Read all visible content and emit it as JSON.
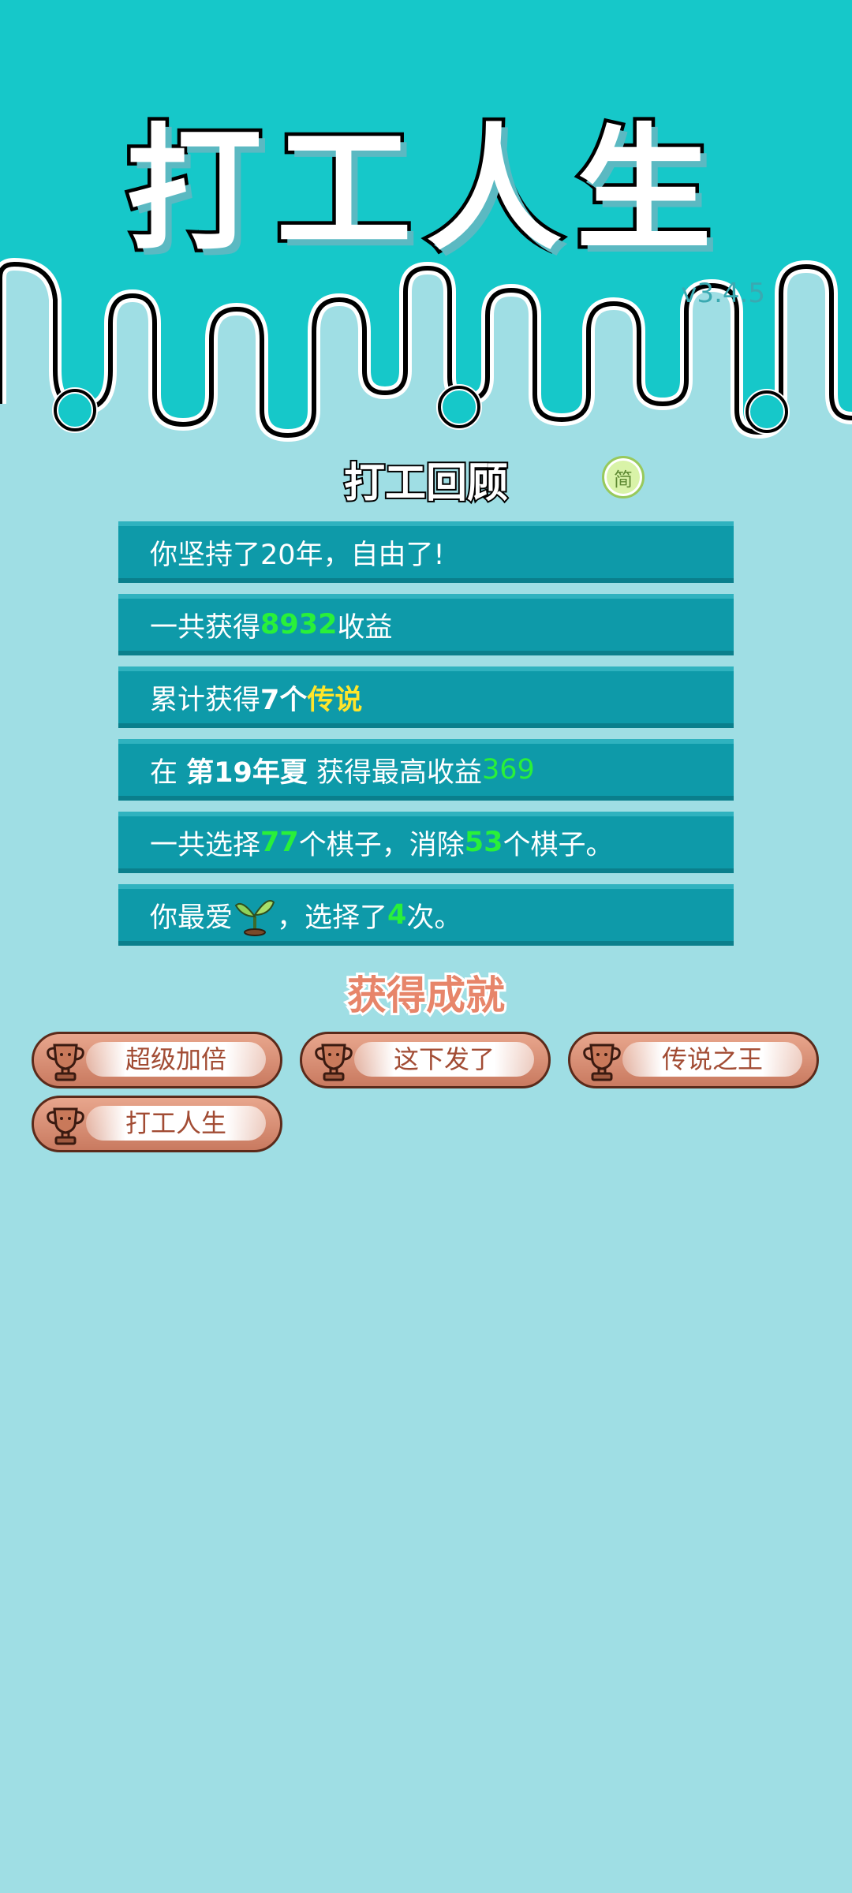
{
  "header": {
    "game_title": "打工人生",
    "version": "v3.4.5"
  },
  "review": {
    "title": "打工回顾",
    "lang_toggle": "简",
    "row1": {
      "text": "你坚持了20年，自由了!"
    },
    "row2": {
      "prefix": "一共获得",
      "value": "8932",
      "suffix": "收益"
    },
    "row3": {
      "prefix": "累计获得",
      "count": "7个",
      "legend": "传说"
    },
    "row4": {
      "prefix": "在 ",
      "season": "第19年夏",
      "middle": " 获得最高收益",
      "value": "369"
    },
    "row5": {
      "p1": "一共选择",
      "selected": "77",
      "p2": "个棋子，消除",
      "removed": "53",
      "p3": "个棋子。"
    },
    "row6": {
      "prefix": "你最爱",
      "icon": "sprout-icon",
      "middle": "，选择了",
      "times": "4",
      "suffix": "次。"
    }
  },
  "achievements": {
    "title": "获得成就",
    "items": [
      {
        "label": "超级加倍",
        "icon": "trophy-icon"
      },
      {
        "label": "这下发了",
        "icon": "trophy-icon"
      },
      {
        "label": "传说之王",
        "icon": "trophy-icon"
      },
      {
        "label": "打工人生",
        "icon": "trophy-icon"
      }
    ]
  },
  "colors": {
    "header_teal": "#16c8c9",
    "background": "#9fdee4",
    "row_teal": "#0e9aa9",
    "highlight_green": "#29f03a",
    "legend_yellow": "#ffe52a",
    "achievement_pink": "#e7856a"
  }
}
